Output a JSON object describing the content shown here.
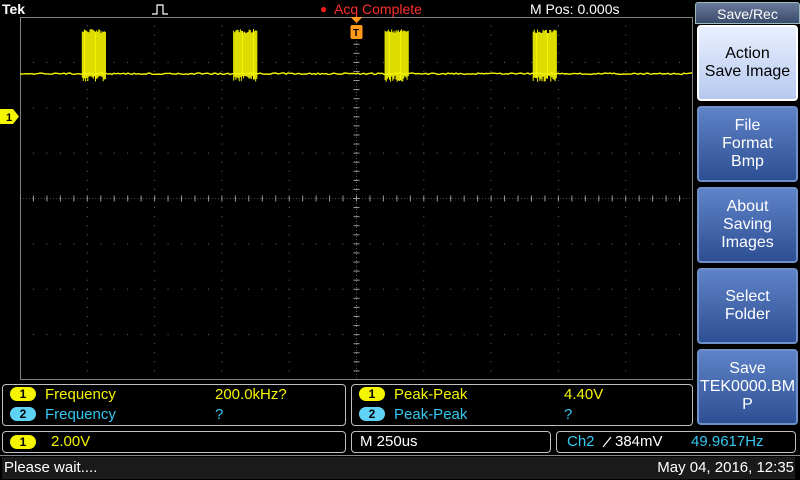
{
  "top": {
    "brand": "Tek",
    "acq_status": "Acq Complete",
    "m_pos": "M Pos: 0.000s"
  },
  "colors": {
    "ch1": "#f5f500",
    "ch2": "#35c8f0",
    "accent": "#ff3030",
    "menu_blue": "#2d4f94"
  },
  "menu": {
    "title": "Save/Rec",
    "buttons": [
      {
        "label": "Action\nSave Image",
        "active": true
      },
      {
        "label": "File\nFormat\nBmp",
        "active": false
      },
      {
        "label": "About\nSaving\nImages",
        "active": false
      },
      {
        "label": "Select\nFolder",
        "active": false
      },
      {
        "label": "Save\nTEK0000.BM\nP",
        "active": false
      }
    ]
  },
  "measurements": {
    "left": [
      {
        "channel": "1",
        "name": "Frequency",
        "value": "200.0kHz?"
      },
      {
        "channel": "2",
        "name": "Frequency",
        "value": "?"
      }
    ],
    "right": [
      {
        "channel": "1",
        "name": "Peak-Peak",
        "value": "4.40V"
      },
      {
        "channel": "2",
        "name": "Peak-Peak",
        "value": "?"
      }
    ]
  },
  "status": {
    "ch1_marker": "1",
    "ch1_scale_channel": "1",
    "ch1_scale": "2.00V",
    "timebase": "M 250us",
    "trigger_source": "Ch2",
    "trigger_level": "384mV",
    "trigger_freq": "49.9617Hz",
    "message": "Please wait....",
    "datetime": "May 04, 2016, 12:35"
  },
  "waveform": {
    "burst_centers_div": [
      1.1,
      3.35,
      5.6,
      7.8
    ],
    "burst_width_div": 0.35,
    "baseline_div": 1.25
  }
}
